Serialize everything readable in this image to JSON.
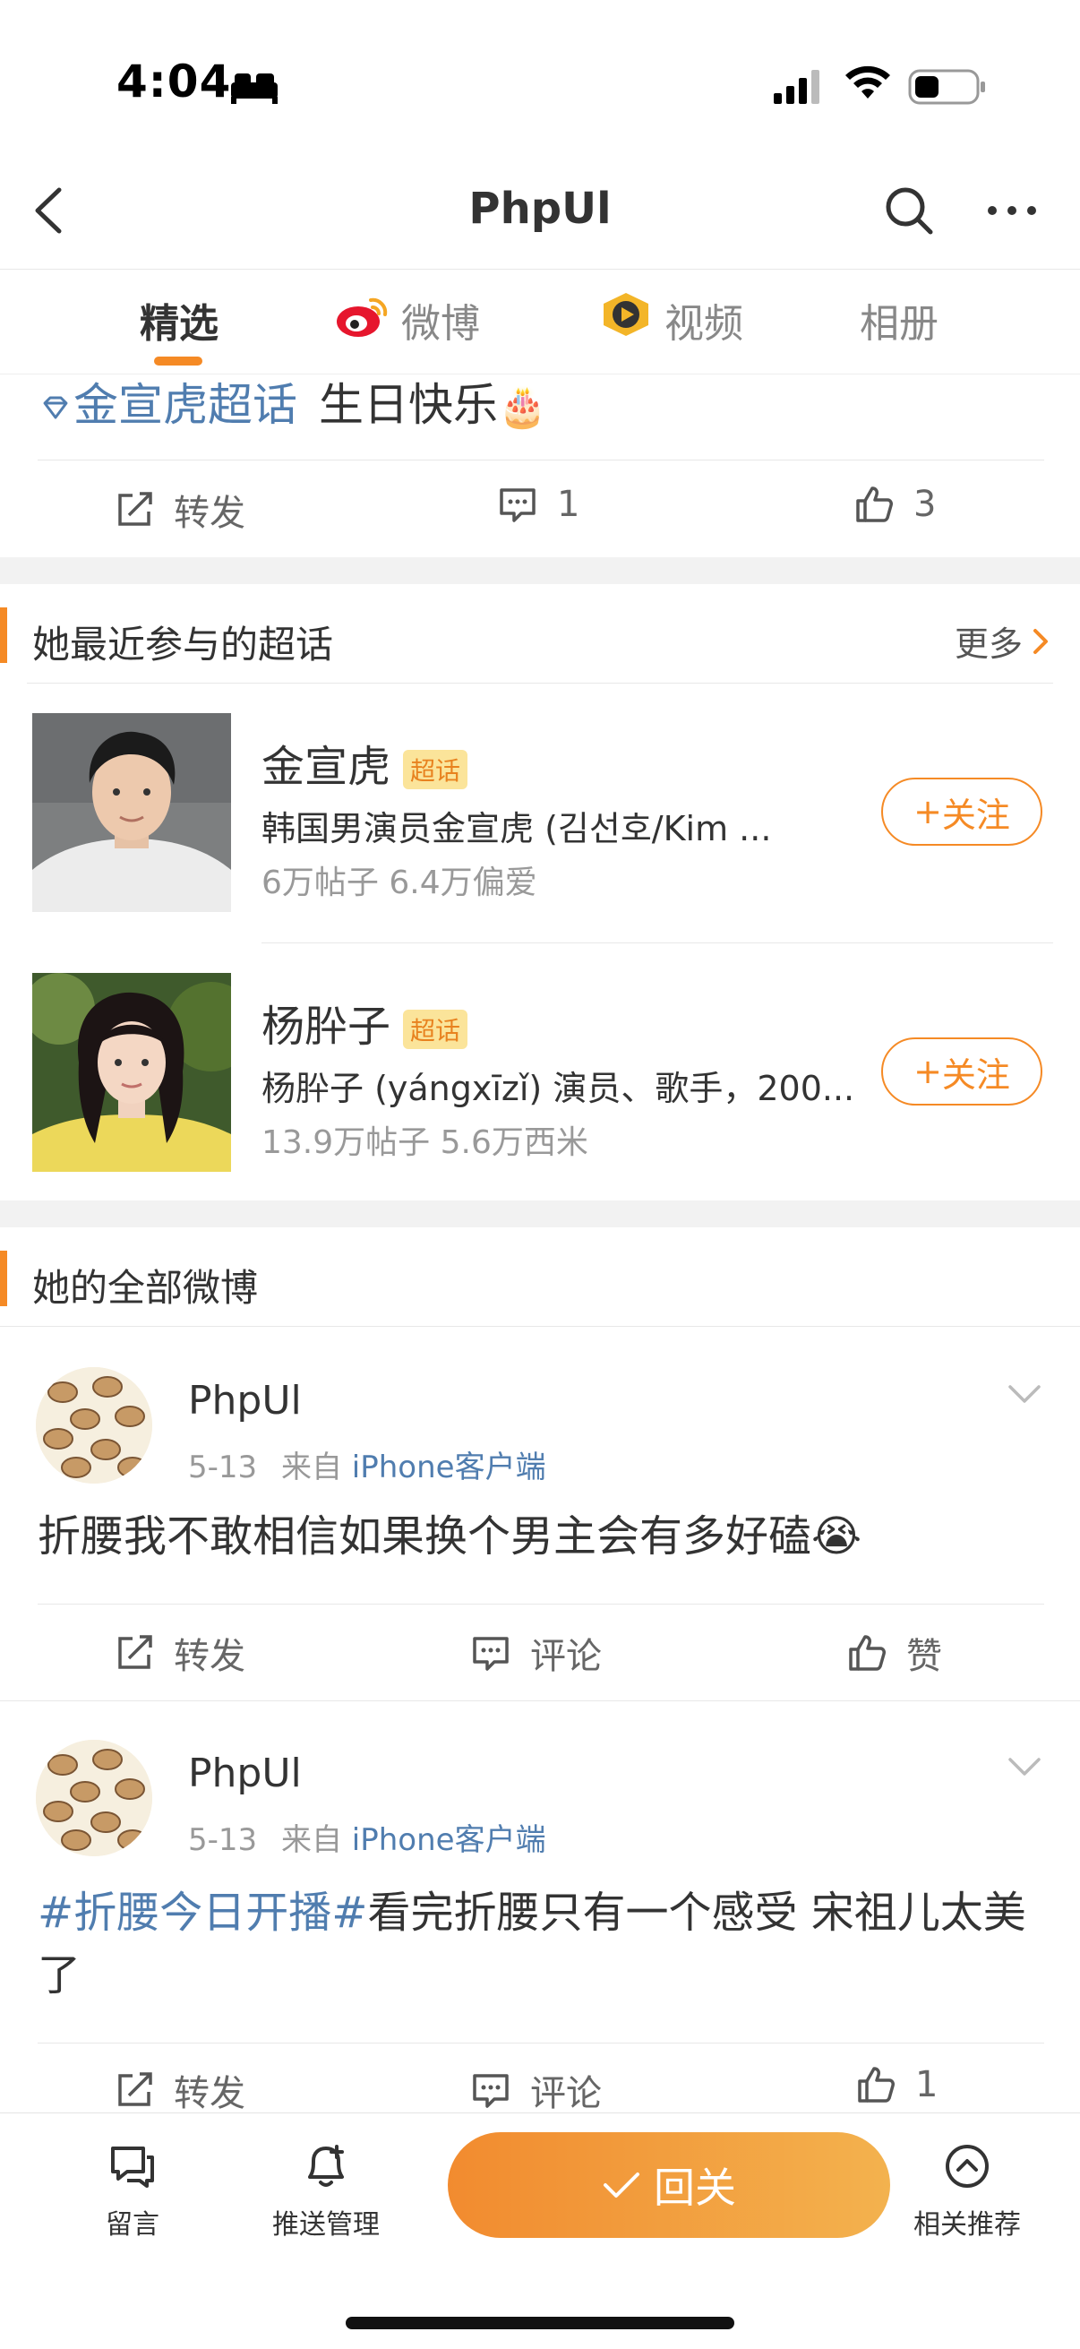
{
  "status_bar": {
    "time": "4:04"
  },
  "nav": {
    "title": "PhpUl"
  },
  "tabs": [
    {
      "label": "精选"
    },
    {
      "label": "微博"
    },
    {
      "label": "视频"
    },
    {
      "label": "相册"
    }
  ],
  "top_post": {
    "topic": "金宣虎超话",
    "text": "生日快乐",
    "cake": "🎂",
    "actions": {
      "repost": "转发",
      "comments": "1",
      "likes": "3"
    }
  },
  "supertopics": {
    "title": "她最近参与的超话",
    "more": "更多",
    "items": [
      {
        "name": "金宣虎",
        "badge": "超话",
        "desc": "韩国男演员金宣虎 (김선호/Kim ...",
        "stats": "6万帖子 6.4万偏爱",
        "follow": "关注"
      },
      {
        "name": "杨肸子",
        "badge": "超话",
        "desc": "杨肸子 (yángxīzǐ) 演员、歌手，200...",
        "stats": "13.9万帖子 5.6万西米",
        "follow": "关注"
      }
    ]
  },
  "all_posts": {
    "title": "她的全部微博",
    "posts": [
      {
        "user": "PhpUl",
        "date": "5-13",
        "from": "来自",
        "source": "iPhone客户端",
        "text": "折腰我不敢相信如果换个男主会有多好磕",
        "emoji": "😭",
        "actions": {
          "repost": "转发",
          "comment": "评论",
          "like": "赞"
        }
      },
      {
        "user": "PhpUl",
        "date": "5-13",
        "from": "来自",
        "source": "iPhone客户端",
        "hashtag": "#折腰今日开播#",
        "text": "看完折腰只有一个感受 宋祖儿太美了",
        "actions": {
          "repost": "转发",
          "comment": "评论",
          "like": "1"
        }
      }
    ]
  },
  "bottom_bar": {
    "message": "留言",
    "push": "推送管理",
    "pass": "回关",
    "recommend": "相关推荐"
  },
  "colors": {
    "accent": "#f58a25",
    "link": "#507daf",
    "badge_bg": "#fbe49a"
  }
}
